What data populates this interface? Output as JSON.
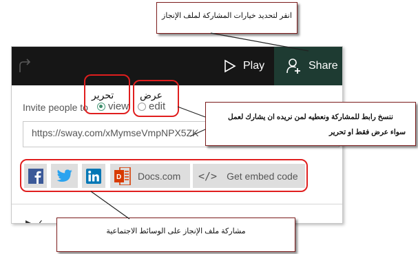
{
  "toolbar": {
    "play_label": "Play",
    "share_label": "Share",
    "bg_color": "#161616",
    "share_bg_color": "#1e3b32"
  },
  "share_panel": {
    "invite_label": "Invite people to",
    "view_option": {
      "label": "view",
      "arabic_label": "تحرير",
      "selected": true
    },
    "edit_option": {
      "label": "edit",
      "arabic_label": "عرض",
      "selected": false
    },
    "url": "https://sway.com/xMymseVmpNPX5ZK"
  },
  "social_buttons": [
    {
      "name": "facebook",
      "icon": "facebook-icon",
      "color": "#3b5998"
    },
    {
      "name": "twitter",
      "icon": "twitter-icon",
      "color": "#1da1f2"
    },
    {
      "name": "linkedin",
      "icon": "linkedin-icon",
      "color": "#0077b5"
    },
    {
      "name": "docs",
      "icon": "docs-icon",
      "label": "Docs.com",
      "color": "#d83b01"
    },
    {
      "name": "embed",
      "icon": "code-icon",
      "label": "Get embed code"
    }
  ],
  "annotations": {
    "top_callout": "انقر لتحديد خيارات المشاركة لملف الإنجاز",
    "right_callout_line1": "ننسخ رابط للمشاركة ونعطيه لمن نريده ان يشارك لعمل",
    "right_callout_line2": "سواء عرض فقط او تحرير",
    "bottom_callout": "مشاركة ملف الإنجاز على الوسائط الاجتماعية",
    "highlight_color": "#e01e1e"
  }
}
